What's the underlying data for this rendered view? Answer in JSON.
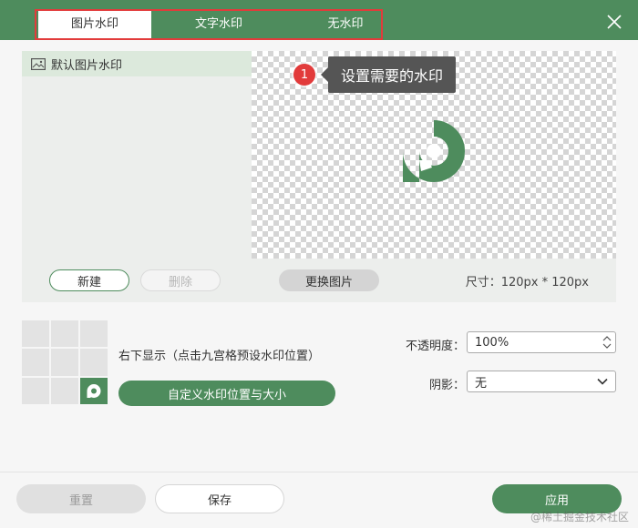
{
  "tabs": [
    {
      "label": "图片水印",
      "active": true
    },
    {
      "label": "文字水印",
      "active": false
    },
    {
      "label": "无水印",
      "active": false
    }
  ],
  "watermark_list": {
    "items": [
      {
        "label": "默认图片水印",
        "selected": true
      }
    ],
    "new_label": "新建",
    "delete_label": "删除"
  },
  "tooltip": {
    "step": "1",
    "text": "设置需要的水印"
  },
  "preview": {
    "replace_label": "更换图片",
    "size_text": "尺寸：120px * 120px"
  },
  "position": {
    "grid_selected": "bottom-right",
    "description": "右下显示（点击九宫格预设水印位置）",
    "custom_label": "自定义水印位置与大小"
  },
  "settings": {
    "opacity_label": "不透明度：",
    "opacity_value": "100%",
    "shadow_label": "阴影：",
    "shadow_value": "无"
  },
  "footer": {
    "reset_label": "重置",
    "save_label": "保存",
    "apply_label": "应用",
    "site_watermark": "@稀土掘金技术社区"
  },
  "colors": {
    "brand": "#4e8c5d",
    "highlight_border": "#e23b3b"
  }
}
